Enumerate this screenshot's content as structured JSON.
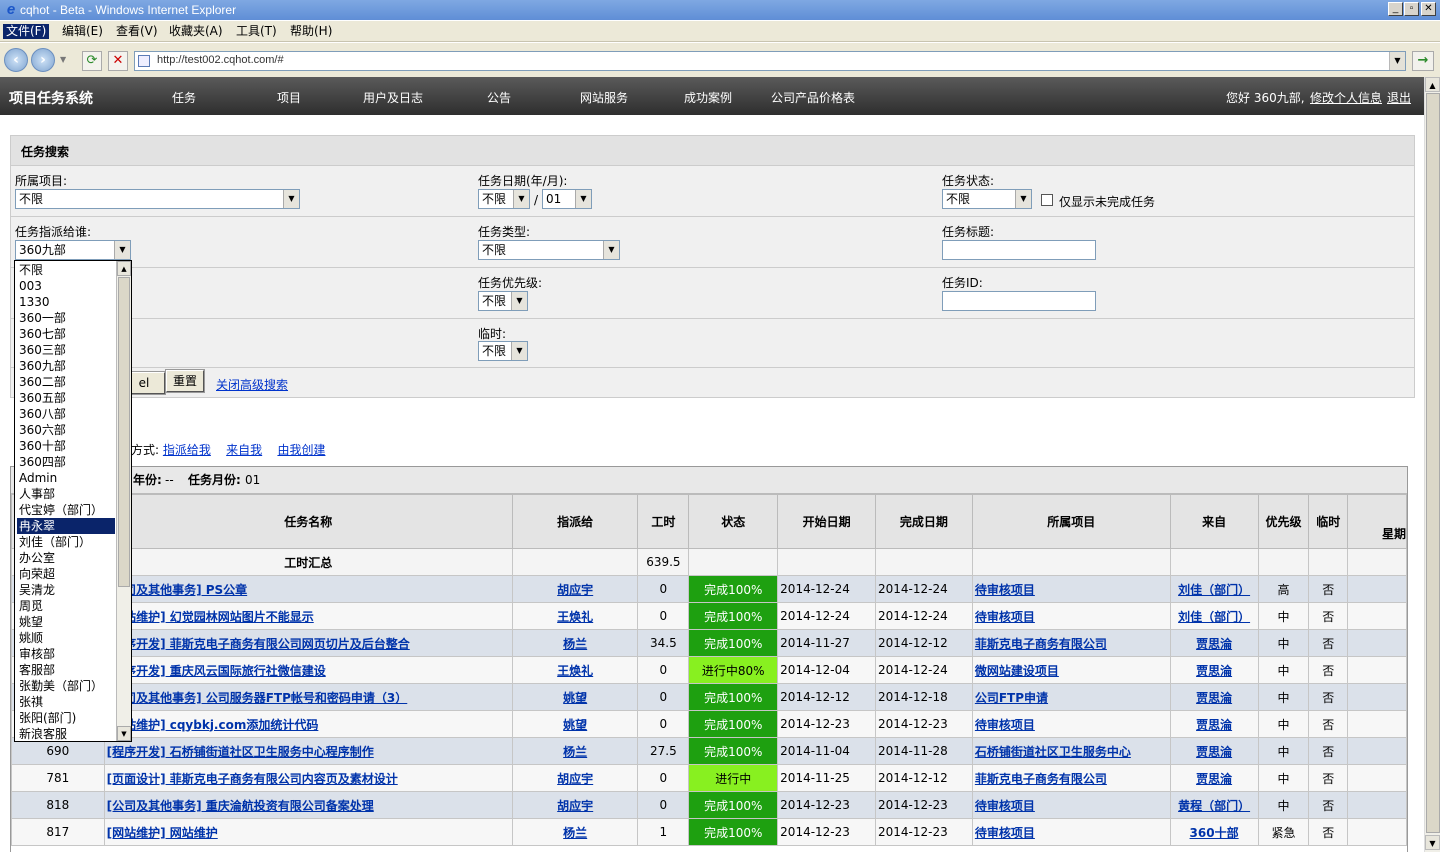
{
  "window": {
    "title": "cqhot - Beta - Windows Internet Explorer"
  },
  "menu": [
    "文件(F)",
    "编辑(E)",
    "查看(V)",
    "收藏夹(A)",
    "工具(T)",
    "帮助(H)"
  ],
  "address": {
    "url": "http://test002.cqhot.com/#"
  },
  "app": {
    "logo": "项目任务系统",
    "nav": [
      "任务",
      "项目",
      "用户及日志",
      "公告",
      "网站服务",
      "成功案例",
      "公司产品价格表"
    ],
    "greeting": "您好 360九部,",
    "profile_link": "修改个人信息",
    "logout": "退出"
  },
  "search": {
    "title": "任务搜索",
    "project_label": "所属项目:",
    "project_value": "不限",
    "date_label": "任务日期(年/月):",
    "year_value": "不限",
    "slash": "/",
    "month_value": "01",
    "status_label": "任务状态:",
    "status_value": "不限",
    "unfinished_label": "仅显示未完成任务",
    "assignee_label": "任务指派给谁:",
    "assignee_value": "360九部",
    "type_label": "任务类型:",
    "type_value": "不限",
    "title_label": "任务标题:",
    "priority_label": "任务优先级:",
    "priority_value": "不限",
    "id_label": "任务ID:",
    "temp_label": "临时:",
    "temp_value": "不限",
    "excel_btn": "el",
    "reset_btn": "重置",
    "close_adv": "关闭高级搜索"
  },
  "dropdown_options": [
    "不限",
    "003",
    "1330",
    "360一部",
    "360七部",
    "360三部",
    "360九部",
    "360二部",
    "360五部",
    "360八部",
    "360六部",
    "360十部",
    "360四部",
    "Admin",
    "人事部",
    "代宝婷（部门）",
    "冉永翠",
    "刘佳（部门）",
    "办公室",
    "向荣超",
    "吴清龙",
    "周觅",
    "姚望",
    "姚顺",
    "审核部",
    "客服部",
    "张勤美（部门）",
    "张祺",
    "张阳(部门)",
    "新浪客服"
  ],
  "dropdown_selected": 16,
  "viewmode": {
    "prefix": "方式:",
    "assigned": "指派给我",
    "from_me": "来自我",
    "created": "由我创建"
  },
  "grid": {
    "caption_year_label": "年份:",
    "caption_year": "--",
    "caption_month_label": "任务月份:",
    "caption_month": "01",
    "headers": [
      "",
      "任务名称",
      "指派给",
      "工时",
      "状态",
      "开始日期",
      "完成日期",
      "所属项目",
      "来自",
      "优先级",
      "临时",
      "星期"
    ],
    "summary_label": "工时汇总",
    "summary_hours": "639.5",
    "rows": [
      {
        "id": "",
        "name": "[公司及其他事务] PS公章",
        "assignee": "胡应宇",
        "hours": "0",
        "status": "完成100%",
        "st": "done",
        "start": "2014-12-24",
        "end": "2014-12-24",
        "project": "待审核项目",
        "from": "刘佳（部门）",
        "pri": "高",
        "temp": "否"
      },
      {
        "id": "",
        "name": "[网站维护] 幻觉园林网站图片不能显示",
        "assignee": "王焕礼",
        "hours": "0",
        "status": "完成100%",
        "st": "done",
        "start": "2014-12-24",
        "end": "2014-12-24",
        "project": "待审核项目",
        "from": "刘佳（部门）",
        "pri": "中",
        "temp": "否"
      },
      {
        "id": "",
        "name": "[程序开发] 菲斯克电子商务有限公司网页切片及后台整合",
        "assignee": "杨兰",
        "hours": "34.5",
        "status": "完成100%",
        "st": "done",
        "start": "2014-11-27",
        "end": "2014-12-12",
        "project": "菲斯克电子商务有限公司",
        "from": "贾思淪",
        "pri": "中",
        "temp": "否"
      },
      {
        "id": "",
        "name": "[程序开发] 重庆风云国际旅行社微信建设",
        "assignee": "王焕礼",
        "hours": "0",
        "status": "进行中80%",
        "st": "prog",
        "start": "2014-12-04",
        "end": "2014-12-24",
        "project": "微网站建设项目",
        "from": "贾思淪",
        "pri": "中",
        "temp": "否"
      },
      {
        "id": "",
        "name": "[公司及其他事务] 公司服务器FTP帐号和密码申请（3）",
        "assignee": "姚望",
        "hours": "0",
        "status": "完成100%",
        "st": "done",
        "start": "2014-12-12",
        "end": "2014-12-18",
        "project": "公司FTP申请",
        "from": "贾思淪",
        "pri": "中",
        "temp": "否"
      },
      {
        "id": "",
        "name": "[网站维护] cqybkj.com添加统计代码",
        "assignee": "姚望",
        "hours": "0",
        "status": "完成100%",
        "st": "done",
        "start": "2014-12-23",
        "end": "2014-12-23",
        "project": "待审核项目",
        "from": "贾思淪",
        "pri": "中",
        "temp": "否"
      },
      {
        "id": "690",
        "name": "[程序开发] 石桥铺街道社区卫生服务中心程序制作",
        "assignee": "杨兰",
        "hours": "27.5",
        "status": "完成100%",
        "st": "done",
        "start": "2014-11-04",
        "end": "2014-11-28",
        "project": "石桥铺街道社区卫生服务中心",
        "from": "贾思淪",
        "pri": "中",
        "temp": "否"
      },
      {
        "id": "781",
        "name": "[页面设计] 菲斯克电子商务有限公司内容页及素材设计",
        "assignee": "胡应宇",
        "hours": "0",
        "status": "进行中",
        "st": "prog",
        "start": "2014-11-25",
        "end": "2014-12-12",
        "project": "菲斯克电子商务有限公司",
        "from": "贾思淪",
        "pri": "中",
        "temp": "否"
      },
      {
        "id": "818",
        "name": "[公司及其他事务] 重庆淪航投资有限公司备案处理",
        "assignee": "胡应宇",
        "hours": "0",
        "status": "完成100%",
        "st": "done",
        "start": "2014-12-23",
        "end": "2014-12-23",
        "project": "待审核项目",
        "from": "黄程（部门）",
        "pri": "中",
        "temp": "否"
      },
      {
        "id": "817",
        "name": "[网站维护] 网站维护",
        "assignee": "杨兰",
        "hours": "1",
        "status": "完成100%",
        "st": "done",
        "start": "2014-12-23",
        "end": "2014-12-23",
        "project": "待审核项目",
        "from": "360十部",
        "pri": "紧急",
        "temp": "否"
      }
    ]
  }
}
